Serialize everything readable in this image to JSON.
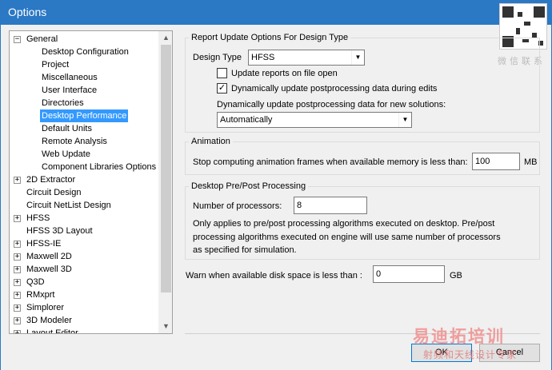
{
  "window": {
    "title": "Options"
  },
  "tree": {
    "items": [
      {
        "label": "General",
        "expander": "−",
        "level": 0
      },
      {
        "label": "Desktop Configuration",
        "expander": "",
        "level": 1
      },
      {
        "label": "Project",
        "expander": "",
        "level": 1
      },
      {
        "label": "Miscellaneous",
        "expander": "",
        "level": 1
      },
      {
        "label": "User Interface",
        "expander": "",
        "level": 1
      },
      {
        "label": "Directories",
        "expander": "",
        "level": 1
      },
      {
        "label": "Desktop Performance",
        "expander": "",
        "level": 1,
        "selected": true
      },
      {
        "label": "Default Units",
        "expander": "",
        "level": 1
      },
      {
        "label": "Remote Analysis",
        "expander": "",
        "level": 1
      },
      {
        "label": "Web Update",
        "expander": "",
        "level": 1
      },
      {
        "label": "Component Libraries Options",
        "expander": "",
        "level": 1
      },
      {
        "label": "2D Extractor",
        "expander": "+",
        "level": 0
      },
      {
        "label": "Circuit Design",
        "expander": "",
        "level": 0
      },
      {
        "label": "Circuit NetList Design",
        "expander": "",
        "level": 0
      },
      {
        "label": "HFSS",
        "expander": "+",
        "level": 0
      },
      {
        "label": "HFSS 3D Layout",
        "expander": "",
        "level": 0
      },
      {
        "label": "HFSS-IE",
        "expander": "+",
        "level": 0
      },
      {
        "label": "Maxwell 2D",
        "expander": "+",
        "level": 0
      },
      {
        "label": "Maxwell 3D",
        "expander": "+",
        "level": 0
      },
      {
        "label": "Q3D",
        "expander": "+",
        "level": 0
      },
      {
        "label": "RMxprt",
        "expander": "+",
        "level": 0
      },
      {
        "label": "Simplorer",
        "expander": "+",
        "level": 0
      },
      {
        "label": "3D Modeler",
        "expander": "+",
        "level": 0
      },
      {
        "label": "Layout Editor",
        "expander": "+",
        "level": 0
      }
    ]
  },
  "report_update": {
    "group_title": "Report Update Options For Design Type",
    "design_type_label": "Design Type",
    "design_type_value": "HFSS",
    "update_on_open_label": "Update reports on file open",
    "update_on_open_checked": false,
    "dynamic_update_label": "Dynamically update postprocessing data during edits",
    "dynamic_update_checked": true,
    "new_solutions_label": "Dynamically update postprocessing data for new solutions:",
    "new_solutions_value": "Automatically"
  },
  "animation": {
    "group_title": "Animation",
    "stop_label": "Stop computing animation frames when available memory is less than:",
    "stop_value": "100",
    "unit": "MB"
  },
  "prepost": {
    "group_title": "Desktop Pre/Post Processing",
    "processors_label": "Number of processors:",
    "processors_value": "8",
    "note_line1": "Only applies to pre/post processing algorithms executed on desktop. Pre/post",
    "note_line2": "processing algorithms executed on engine will use same number of processors",
    "note_line3": "as specified for simulation."
  },
  "disk": {
    "label": "Warn when available disk space is less than :",
    "value": "0",
    "unit": "GB"
  },
  "buttons": {
    "ok": "OK",
    "cancel": "Cancel"
  },
  "watermark": {
    "wechat": "微信联系",
    "logo": "易迪拓培训",
    "sub": "射频和天线设计专家"
  },
  "colors": {
    "titlebar": "#2b78c4",
    "selection": "#3399ff"
  }
}
